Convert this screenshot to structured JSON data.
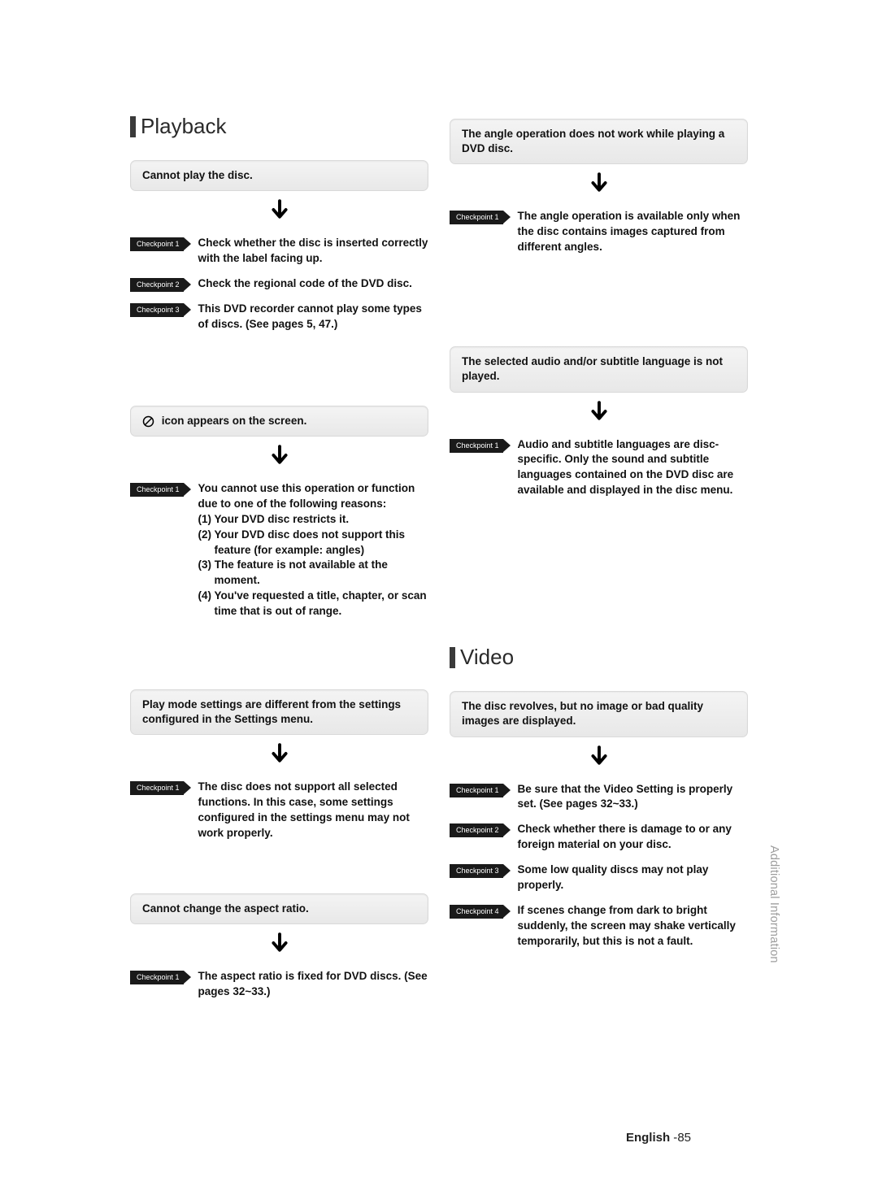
{
  "side_tab": "Additional Information",
  "footer": {
    "label": "English",
    "page_prefix": " -",
    "page_num": "85"
  },
  "labels": {
    "checkpoint": [
      "Checkpoint 1",
      "Checkpoint 2",
      "Checkpoint 3",
      "Checkpoint 4"
    ]
  },
  "playback_heading": "Playback",
  "video_heading": "Video",
  "left_column": [
    {
      "type": "heading-ref",
      "heading_key": "playback_heading"
    },
    {
      "type": "symptom-block",
      "symptom": "Cannot play the disc.",
      "checkpoints": [
        {
          "label_idx": 0,
          "text": "Check whether the disc is inserted correctly with the label facing up."
        },
        {
          "label_idx": 1,
          "text": "Check the regional code of the DVD disc."
        },
        {
          "label_idx": 2,
          "text": "This DVD recorder cannot play some types of discs. (See pages 5, 47.)"
        }
      ],
      "spacer_after": 60
    },
    {
      "type": "symptom-block",
      "symptom_icon": "ban",
      "symptom": "icon appears on the screen.",
      "checkpoints": [
        {
          "label_idx": 0,
          "text": "You cannot use this operation or function due to one of the following reasons:",
          "sublist": [
            "(1) Your DVD disc restricts it.",
            "(2) Your DVD disc does not support this feature (for example: angles)",
            "(3) The feature is not available at the moment.",
            "(4) You've requested a title, chapter, or scan time that is out of range."
          ]
        }
      ],
      "spacer_after": 56
    },
    {
      "type": "symptom-block",
      "symptom": "Play mode settings are different from the settings configured in the Settings menu.",
      "checkpoints": [
        {
          "label_idx": 0,
          "text": "The disc does not support all selected functions. In this case, some settings configured in the settings menu may not work properly."
        }
      ],
      "spacer_after": 34
    },
    {
      "type": "symptom-block",
      "symptom": "Cannot change the aspect ratio.",
      "checkpoints": [
        {
          "label_idx": 0,
          "text": "The aspect ratio is fixed for DVD discs. (See pages 32~33.)"
        }
      ]
    }
  ],
  "right_column": [
    {
      "type": "symptom-block",
      "spacer_before": 6,
      "symptom": "The angle operation does not work while playing a DVD disc.",
      "checkpoints": [
        {
          "label_idx": 0,
          "text": "The angle operation is available only when the disc contains images captured from different angles."
        }
      ],
      "spacer_after": 82
    },
    {
      "type": "symptom-block",
      "symptom": "The selected audio and/or subtitle language is not played.",
      "checkpoints": [
        {
          "label_idx": 0,
          "text": "Audio and subtitle languages are disc-specific. Only the sound and subtitle languages contained on the DVD disc are available and displayed in the disc menu."
        }
      ],
      "spacer_after": 150
    },
    {
      "type": "heading-ref",
      "heading_key": "video_heading"
    },
    {
      "type": "symptom-block",
      "symptom": "The disc revolves, but no image or bad quality images are displayed.",
      "checkpoints": [
        {
          "label_idx": 0,
          "text": "Be sure that the Video Setting is properly set. (See pages 32~33.)"
        },
        {
          "label_idx": 1,
          "text": "Check whether there is damage to or any foreign material on your disc."
        },
        {
          "label_idx": 2,
          "text": "Some low quality discs may not play properly."
        },
        {
          "label_idx": 3,
          "text": "If scenes change from dark to bright suddenly, the screen may shake vertically temporarily, but this is not a fault."
        }
      ]
    }
  ]
}
